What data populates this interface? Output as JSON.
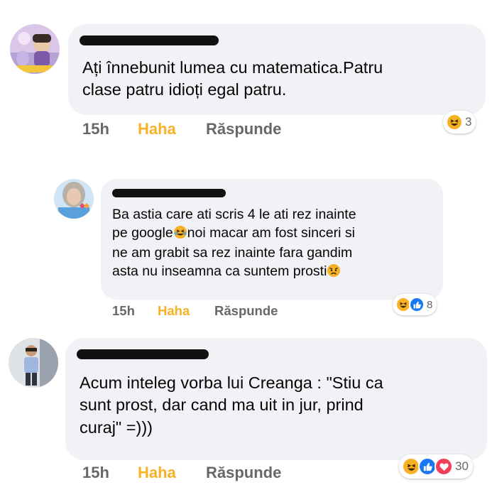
{
  "colors": {
    "bubble": "#f0f2f5",
    "haha": "#f7b125",
    "meta": "#65676b",
    "text": "#050505",
    "like": "#1877f2",
    "love": "#f33e58"
  },
  "comments": [
    {
      "text_lines": [
        "Ați înnebunit lumea cu matematica.Patru",
        "clase patru idioți egal patru."
      ],
      "time": "15h",
      "reaction_label": "Haha",
      "reply_label": "Răspunde",
      "reactions": [
        "haha-icon"
      ],
      "reaction_count": "3"
    },
    {
      "text_lines": [
        "Ba astia care ati scris 4 le ati rez inainte",
        "pe google",
        "noi macar am fost sinceri si",
        "ne am grabit sa rez inainte fara gandim",
        "asta nu inseamna ca suntem prosti"
      ],
      "time": "15h",
      "reaction_label": "Haha",
      "reply_label": "Răspunde",
      "reactions": [
        "haha-icon",
        "like-icon"
      ],
      "reaction_count": "8"
    },
    {
      "text_lines": [
        "Acum inteleg vorba lui Creanga : \"Stiu ca",
        "sunt prost, dar cand ma uit in jur, prind",
        "curaj\" =)))"
      ],
      "time": "15h",
      "reaction_label": "Haha",
      "reply_label": "Răspunde",
      "reactions": [
        "haha-icon",
        "like-icon",
        "love-icon"
      ],
      "reaction_count": "30"
    }
  ]
}
